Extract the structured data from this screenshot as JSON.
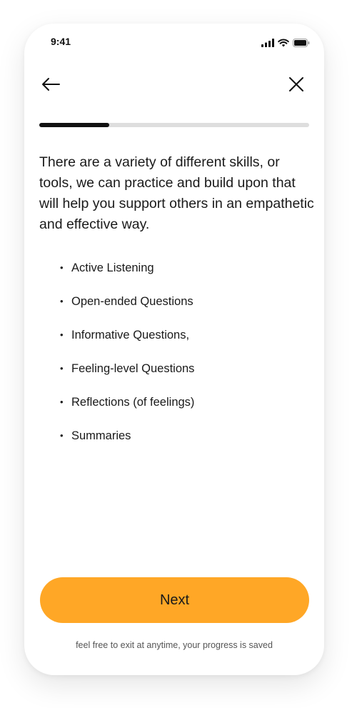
{
  "status_bar": {
    "time": "9:41",
    "icons": [
      "signal-icon",
      "wifi-icon",
      "battery-icon"
    ]
  },
  "nav": {
    "back_icon": "arrow-left-icon",
    "close_icon": "close-icon"
  },
  "progress": {
    "fraction": 0.26
  },
  "content": {
    "intro": "There are a variety of different skills, or tools, we can practice and build upon that will help you support others in an empathetic and effective way.",
    "skills": [
      "Active Listening",
      "Open-ended Questions",
      "Informative Questions,",
      "Feeling-level Questions",
      "Reflections (of feelings)",
      "Summaries"
    ]
  },
  "actions": {
    "next_label": "Next",
    "note": "feel free to exit at anytime, your progress is saved"
  },
  "colors": {
    "accent": "#FFA726",
    "progress_fill": "#111111",
    "progress_track": "#DEDEDE"
  }
}
